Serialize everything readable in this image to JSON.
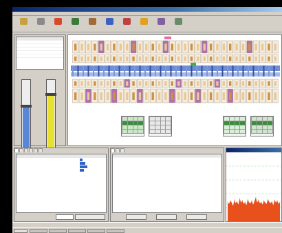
{
  "window": {
    "title": ""
  },
  "menu": [],
  "toolbar": [
    {
      "label": "",
      "color": "#c8a040"
    },
    {
      "label": "",
      "color": "#8a8a8a"
    },
    {
      "label": "",
      "color": "#d84a2a"
    },
    {
      "label": "",
      "color": "#3a7a3a"
    },
    {
      "label": "",
      "color": "#a06a3a"
    },
    {
      "label": "",
      "color": "#4060c0"
    },
    {
      "label": "",
      "color": "#c04040"
    },
    {
      "label": "",
      "color": "#e0a020"
    },
    {
      "label": "",
      "color": "#8060a0"
    },
    {
      "label": "",
      "color": "#6a8a6a"
    }
  ],
  "left_panel": {
    "table": {
      "headers": [
        "",
        "",
        ""
      ],
      "rows": [
        [
          "",
          "",
          ""
        ],
        [
          "",
          "",
          ""
        ],
        [
          "",
          "",
          ""
        ],
        [
          "",
          "",
          ""
        ],
        [
          "",
          "",
          ""
        ]
      ]
    },
    "gauge_left": {
      "label": "",
      "fill": 0.62,
      "color": "#5a86d8"
    },
    "gauge_right": {
      "label": "",
      "fill": 0.78,
      "color": "#e8e030"
    },
    "checkbox_label": "",
    "settings_button": ""
  },
  "chart_view": {
    "upper_teeth": 32,
    "lower_teeth": 32,
    "highlight_color": "#b070b0",
    "implant_color": "#d09040",
    "band_color": "#5878c8",
    "accent_color": "#e070a0",
    "green_marker": "#40b040"
  },
  "info_list": [],
  "grids": [
    {
      "caption": ""
    },
    {
      "caption": ""
    },
    {
      "caption": ""
    },
    {
      "caption": ""
    }
  ],
  "list_panel": {
    "tabs": [
      "",
      "",
      "",
      "",
      "",
      ""
    ],
    "headers": [
      "",
      "",
      "",
      "",
      "",
      "",
      "",
      "",
      ""
    ],
    "rows": [],
    "bar_color": "#2f62c7",
    "bar_levels": [
      0.3,
      0.6,
      0.8,
      0.45
    ],
    "button": ""
  },
  "notes_panel": {
    "tabs": [
      "",
      "",
      ""
    ],
    "headers": [
      "",
      "",
      "",
      ""
    ],
    "rows": [],
    "buttons": [
      "",
      "",
      ""
    ]
  },
  "chart_panel": {
    "title": "",
    "fill_color": "#e8501c",
    "grid_color": "#60c060"
  },
  "chart_data": {
    "type": "area",
    "title": "",
    "xlabel": "",
    "ylabel": "",
    "ylim": [
      0,
      100
    ],
    "series": [
      {
        "values": [
          28,
          25,
          30,
          27,
          22,
          31,
          26,
          29,
          24,
          33,
          27,
          30,
          25,
          28,
          23,
          32,
          27,
          26,
          30,
          24,
          29,
          35,
          27,
          31,
          26,
          28,
          24,
          30,
          27,
          25,
          32,
          28,
          26,
          29,
          23,
          31,
          27,
          30,
          25,
          28
        ]
      }
    ]
  },
  "statusbar": {
    "text": ""
  },
  "taskbar": {
    "start": "",
    "tasks": [
      "",
      "",
      "",
      "",
      ""
    ],
    "clock": ""
  }
}
